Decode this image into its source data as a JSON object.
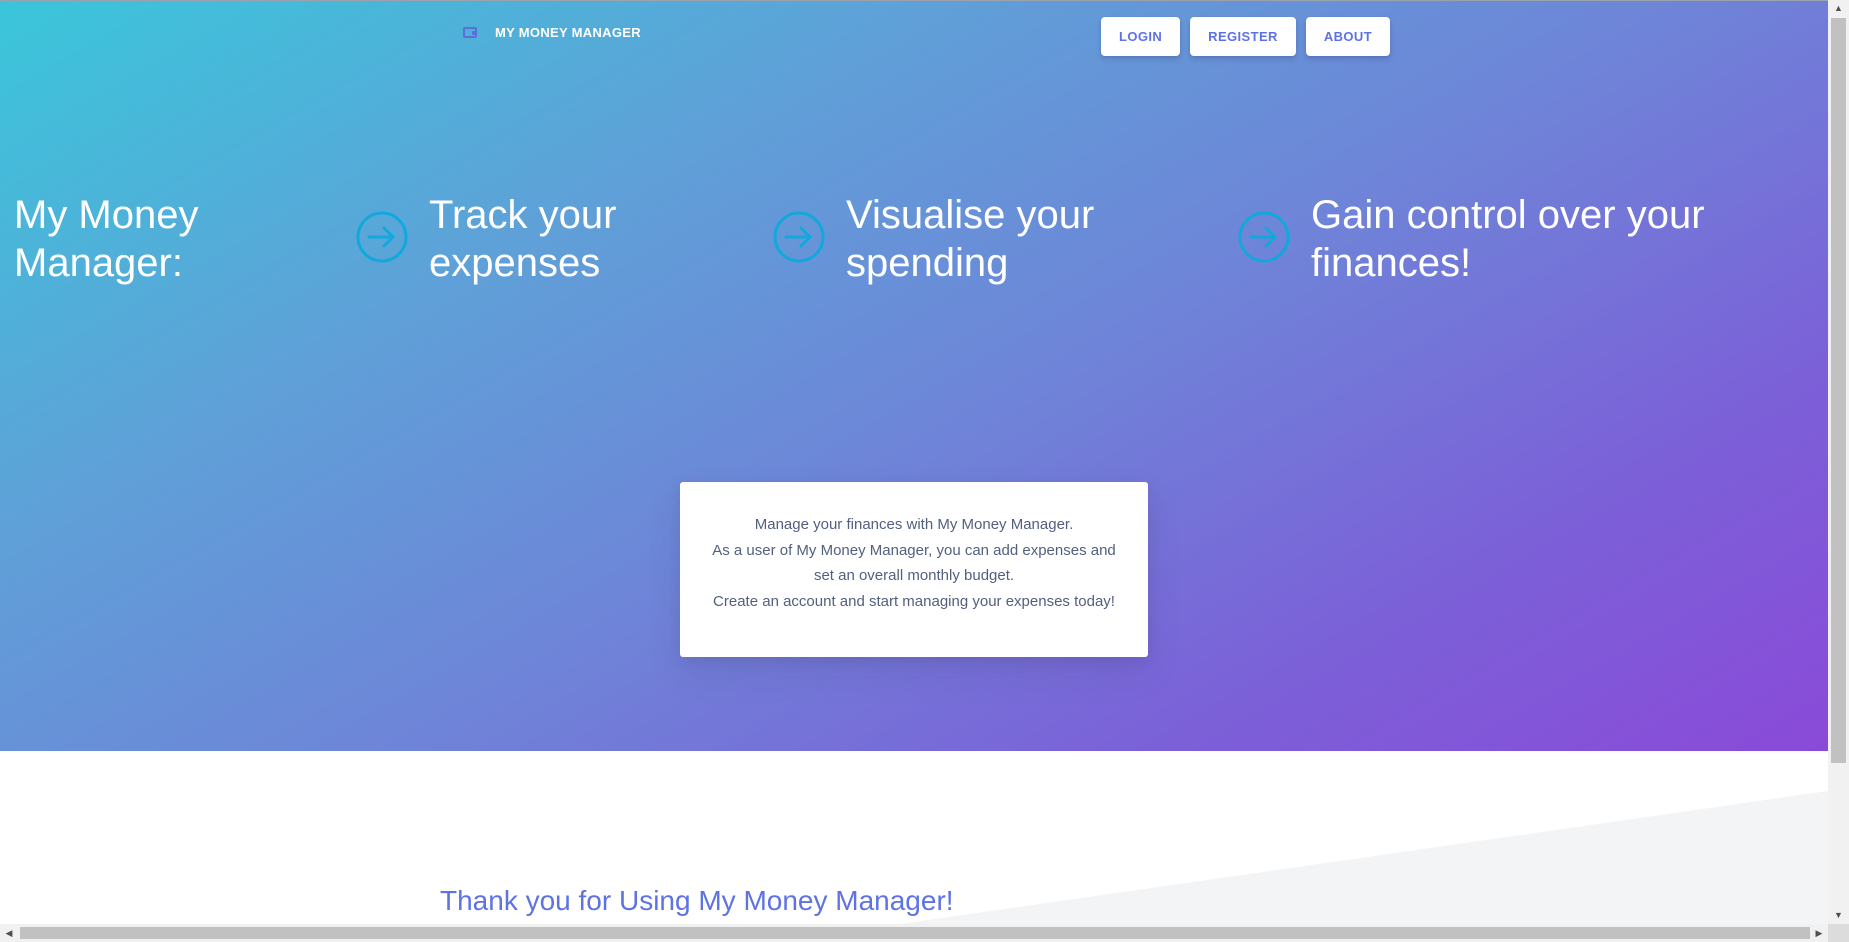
{
  "header": {
    "brand_icon": "wallet-icon",
    "brand_name": "MY MONEY MANAGER",
    "nav": [
      {
        "label": "LOGIN"
      },
      {
        "label": "REGISTER"
      },
      {
        "label": "ABOUT"
      }
    ]
  },
  "hero": {
    "title_line1": "My Money",
    "title_line2": "Manager:",
    "features": [
      {
        "line1": "Track your",
        "line2": "expenses",
        "icon": "arrow-right-circle-icon"
      },
      {
        "line1": "Visualise your",
        "line2": "spending",
        "icon": "arrow-right-circle-icon"
      },
      {
        "line1": "Gain control over your",
        "line2": "finances!",
        "icon": "arrow-right-circle-icon"
      }
    ]
  },
  "intro_card": {
    "line1": "Manage your finances with My Money Manager.",
    "line2": "As a user of My Money Manager, you can add expenses and",
    "line3": "set an overall monthly budget.",
    "line4": "Create an account and start managing your expenses today!"
  },
  "footer": {
    "thanks": "Thank you for Using My Money Manager!"
  },
  "colors": {
    "gradient_start": "#3ac6da",
    "gradient_end": "#8a4ad8",
    "accent": "#5e72e4",
    "arrow_icon": "#11a8dc"
  }
}
